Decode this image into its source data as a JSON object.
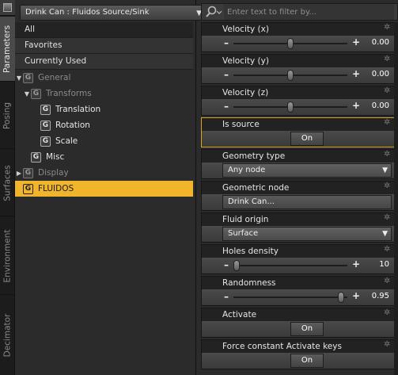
{
  "vtabs": [
    "Parameters",
    "Posing",
    "Surfaces",
    "Environment",
    "Decimator"
  ],
  "node_selector": {
    "value": "Drink Can : Fluidos Source/Sink"
  },
  "filters": [
    "All",
    "Favorites",
    "Currently Used"
  ],
  "tree": [
    {
      "label": "General",
      "group_icon": "G"
    },
    {
      "label": "Transforms",
      "group_icon": "G"
    },
    {
      "label": "Translation",
      "group_icon": "G"
    },
    {
      "label": "Rotation",
      "group_icon": "G"
    },
    {
      "label": "Scale",
      "group_icon": "G"
    },
    {
      "label": "Misc",
      "group_icon": "G"
    },
    {
      "label": "Display",
      "group_icon": "G"
    },
    {
      "label": "FLUIDOS",
      "group_icon": "G"
    }
  ],
  "search": {
    "placeholder": "Enter text to filter by..."
  },
  "properties": [
    {
      "label": "Velocity (x)",
      "type": "slider",
      "value": "0.00",
      "level": 0.5
    },
    {
      "label": "Velocity (y)",
      "type": "slider",
      "value": "0.00",
      "level": 0.5
    },
    {
      "label": "Velocity (z)",
      "type": "slider",
      "value": "0.00",
      "level": 0.5
    },
    {
      "label": "Is source",
      "type": "toggle",
      "value": "On"
    },
    {
      "label": "Geometry type",
      "type": "select",
      "value": "Any node"
    },
    {
      "label": "Geometric node",
      "type": "node",
      "value": "Drink Can..."
    },
    {
      "label": "Fluid origin",
      "type": "select",
      "value": "Surface"
    },
    {
      "label": "Holes density",
      "type": "slider",
      "value": "10",
      "level": 0.0
    },
    {
      "label": "Randomness",
      "type": "slider",
      "value": "0.95",
      "level": 0.97
    },
    {
      "label": "Activate",
      "type": "toggle",
      "value": "On"
    },
    {
      "label": "Force constant Activate keys",
      "type": "toggle",
      "value": "On"
    }
  ],
  "colors": {
    "selection": "#f0b52a",
    "active_border": "#d9a520",
    "panel": "#2b2b2b"
  }
}
